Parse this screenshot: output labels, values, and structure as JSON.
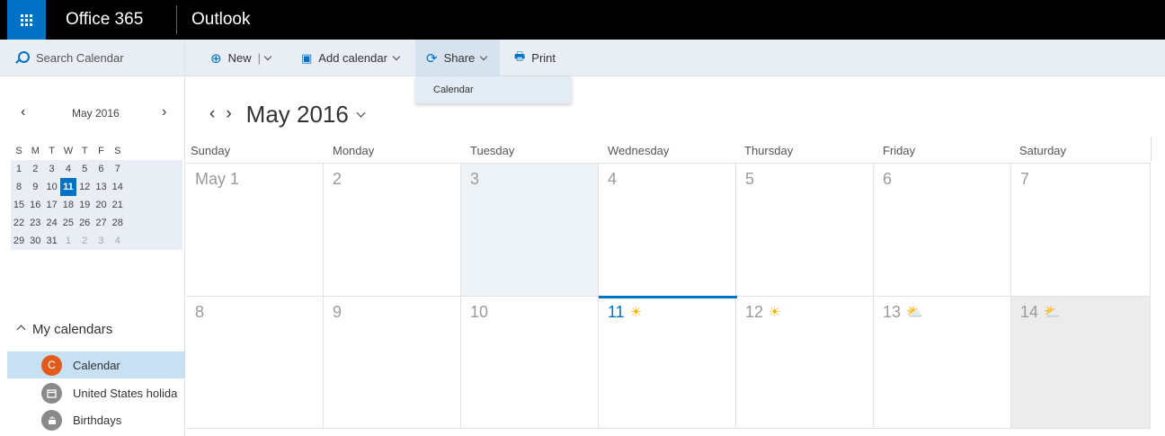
{
  "topbar": {
    "brand": "Office 365",
    "app_name": "Outlook"
  },
  "commandbar": {
    "search_placeholder": "Search Calendar",
    "new_label": "New",
    "new_separator": "|",
    "add_calendar_label": "Add calendar",
    "share_label": "Share",
    "print_label": "Print",
    "share_menu": [
      "Calendar"
    ]
  },
  "mini_calendar": {
    "title": "May 2016",
    "prev": "‹",
    "next": "›",
    "weekdays": [
      "S",
      "M",
      "T",
      "W",
      "T",
      "F",
      "S"
    ],
    "weeks": [
      [
        "1",
        "2",
        "3",
        "4",
        "5",
        "6",
        "7"
      ],
      [
        "8",
        "9",
        "10",
        "11",
        "12",
        "13",
        "14"
      ],
      [
        "15",
        "16",
        "17",
        "18",
        "19",
        "20",
        "21"
      ],
      [
        "22",
        "23",
        "24",
        "25",
        "26",
        "27",
        "28"
      ],
      [
        "29",
        "30",
        "31",
        "1",
        "2",
        "3",
        "4"
      ]
    ],
    "today": "11"
  },
  "my_calendars": {
    "header": "My calendars",
    "items": [
      {
        "label": "Calendar",
        "badge": "C",
        "selected": true,
        "color": "#e25a1c"
      },
      {
        "label": "United States holidays",
        "badge": "",
        "icon": "calendar-icon",
        "color": "#8a8a8a"
      },
      {
        "label": "Birthdays",
        "badge": "",
        "icon": "cake-icon",
        "color": "#8a8a8a"
      }
    ]
  },
  "month_view": {
    "title": "May 2016",
    "prev": "‹",
    "next": "›",
    "weekdays": [
      "Sunday",
      "Monday",
      "Tuesday",
      "Wednesday",
      "Thursday",
      "Friday",
      "Saturday"
    ],
    "week1": [
      "May 1",
      "2",
      "3",
      "4",
      "5",
      "6",
      "7"
    ],
    "week2": [
      "8",
      "9",
      "10",
      "11",
      "12",
      "13",
      "14"
    ],
    "weather": {
      "11": "sunny-icon",
      "12": "sunny-icon",
      "13": "partly-cloudy-icon",
      "14": "partly-cloudy-icon"
    }
  },
  "colors": {
    "accent": "#0072c6",
    "share_active": "#d6e2ee",
    "selected_calendar": "#c7e0f4"
  }
}
